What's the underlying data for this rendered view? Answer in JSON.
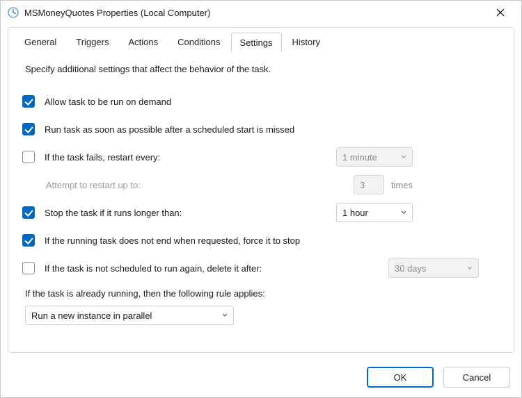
{
  "window": {
    "title": "MSMoneyQuotes Properties (Local Computer)"
  },
  "tabs": {
    "general": "General",
    "triggers": "Triggers",
    "actions": "Actions",
    "conditions": "Conditions",
    "settings": "Settings",
    "history": "History",
    "active": "settings"
  },
  "settings": {
    "description": "Specify additional settings that affect the behavior of the task.",
    "allow_on_demand": {
      "label": "Allow task to be run on demand",
      "checked": true
    },
    "run_asap_after_missed": {
      "label": "Run task as soon as possible after a scheduled start is missed",
      "checked": true
    },
    "restart_on_fail": {
      "label": "If the task fails, restart every:",
      "checked": false,
      "interval_value": "1 minute"
    },
    "restart_attempts": {
      "label": "Attempt to restart up to:",
      "count": "3",
      "suffix": "times"
    },
    "stop_if_longer": {
      "label": "Stop the task if it runs longer than:",
      "checked": true,
      "duration_value": "1 hour"
    },
    "force_stop": {
      "label": "If the running task does not end when requested, force it to stop",
      "checked": true
    },
    "delete_if_not_scheduled": {
      "label": "If the task is not scheduled to run again, delete it after:",
      "checked": false,
      "duration_value": "30 days"
    },
    "already_running_label": "If the task is already running, then the following rule applies:",
    "already_running_rule": "Run a new instance in parallel"
  },
  "buttons": {
    "ok": "OK",
    "cancel": "Cancel"
  }
}
